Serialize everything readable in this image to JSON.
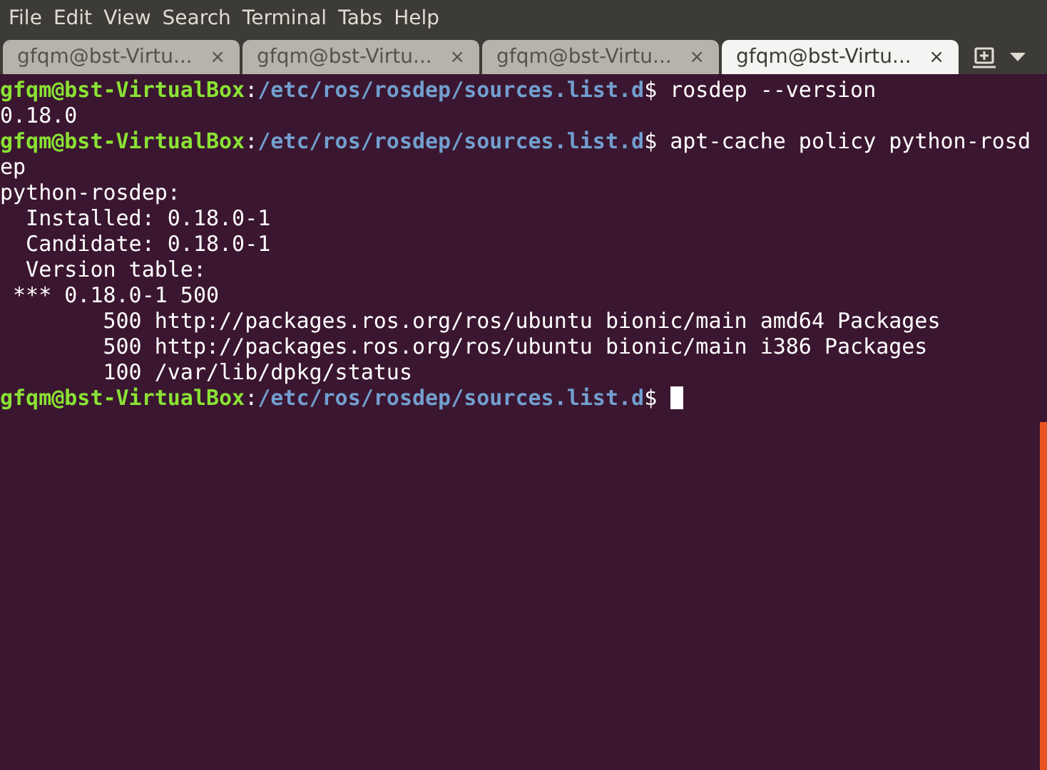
{
  "menu_bar": [
    "File",
    "Edit",
    "View",
    "Search",
    "Terminal",
    "Tabs",
    "Help"
  ],
  "tabs": [
    {
      "label": "gfqm@bst-Virtu...",
      "close": "×",
      "selected": false
    },
    {
      "label": "gfqm@bst-Virtu...",
      "close": "×",
      "selected": false
    },
    {
      "label": "gfqm@bst-Virtu...",
      "close": "×",
      "selected": false
    },
    {
      "label": "gfqm@bst-Virtu...",
      "close": "×",
      "selected": true
    }
  ],
  "terminal": {
    "lines": [
      {
        "kind": "prompt",
        "user": "gfqm@bst-VirtualBox",
        "sep": ":",
        "path": "/etc/ros/rosdep/sources.list.d",
        "command": "$ rosdep --version",
        "cursor": false
      },
      {
        "kind": "output",
        "text": "0.18.0"
      },
      {
        "kind": "prompt",
        "user": "gfqm@bst-VirtualBox",
        "sep": ":",
        "path": "/etc/ros/rosdep/sources.list.d",
        "command": "$ apt-cache policy python-rosd",
        "cursor": false
      },
      {
        "kind": "output",
        "text": "ep"
      },
      {
        "kind": "output",
        "text": "python-rosdep:"
      },
      {
        "kind": "output",
        "text": "  Installed: 0.18.0-1"
      },
      {
        "kind": "output",
        "text": "  Candidate: 0.18.0-1"
      },
      {
        "kind": "output",
        "text": "  Version table:"
      },
      {
        "kind": "output",
        "text": " *** 0.18.0-1 500"
      },
      {
        "kind": "output",
        "text": "        500 http://packages.ros.org/ros/ubuntu bionic/main amd64 Packages"
      },
      {
        "kind": "output",
        "text": "        500 http://packages.ros.org/ros/ubuntu bionic/main i386 Packages"
      },
      {
        "kind": "output",
        "text": "        100 /var/lib/dpkg/status"
      },
      {
        "kind": "prompt",
        "user": "gfqm@bst-VirtualBox",
        "sep": ":",
        "path": "/etc/ros/rosdep/sources.list.d",
        "command": "$ ",
        "cursor": true
      }
    ]
  }
}
